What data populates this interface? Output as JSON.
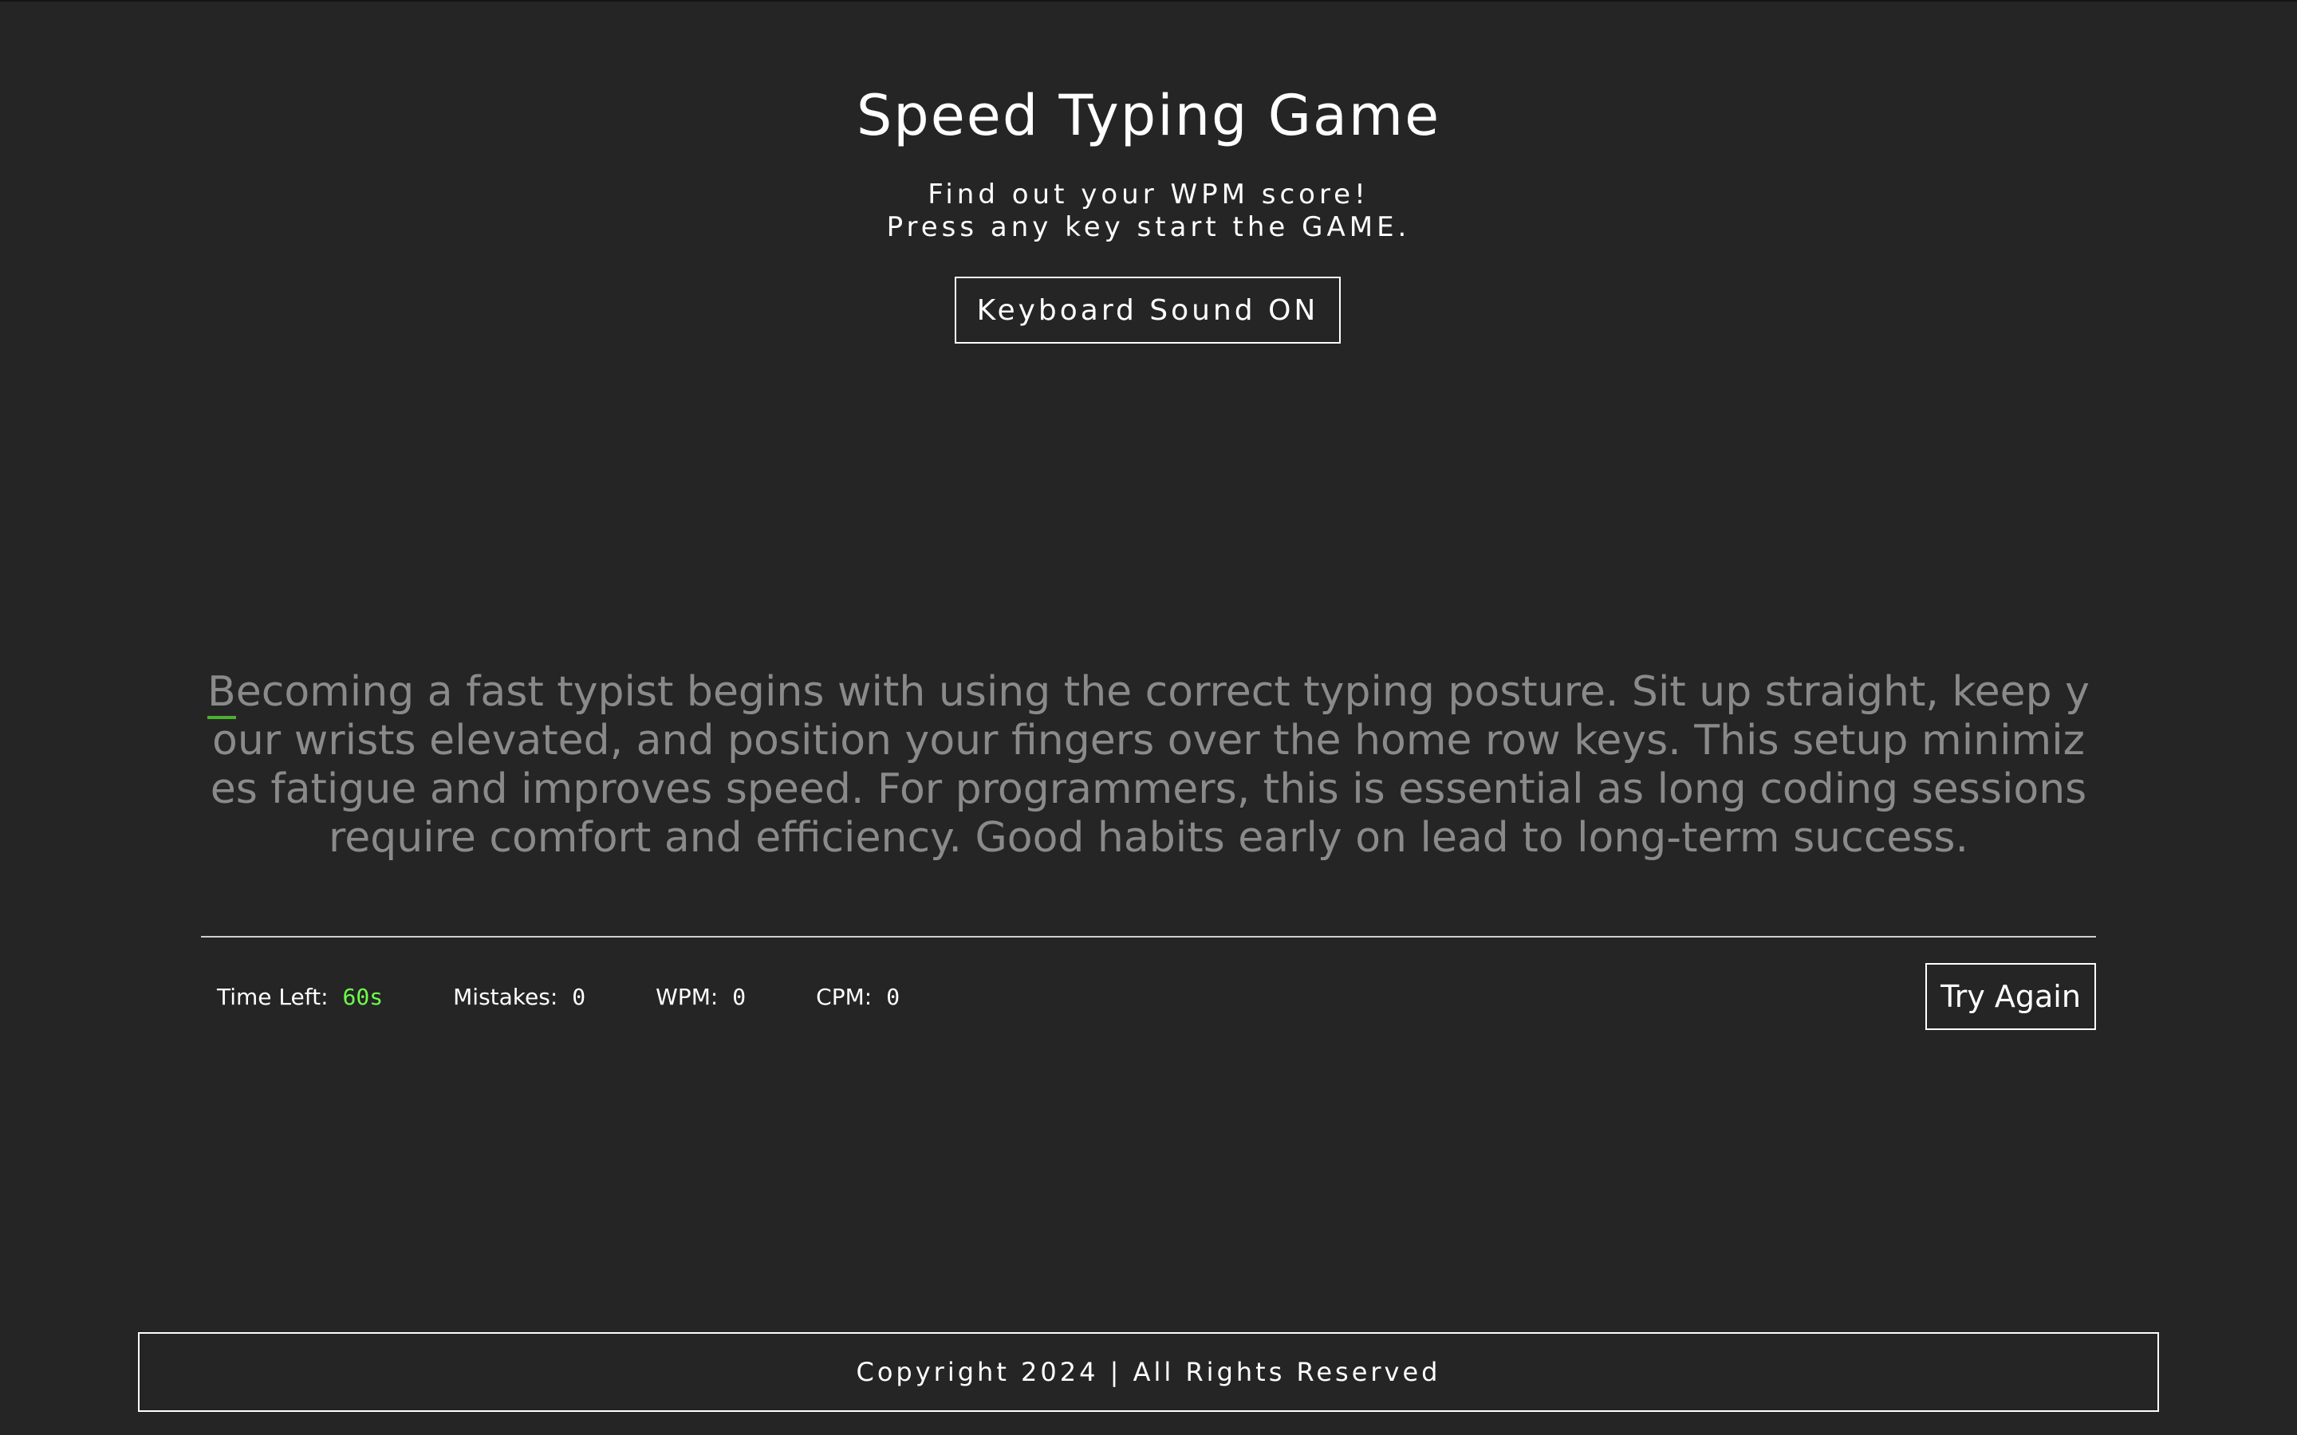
{
  "header": {
    "title": "Speed Typing Game",
    "subtitle_line1": "Find out your WPM score!",
    "subtitle_line2": "Press any key start the GAME.",
    "sound_button_label": "Keyboard Sound ON"
  },
  "passage": {
    "current_char": "B",
    "remaining_text": "ecoming a fast typist begins with using the correct typing posture. Sit up straight, keep your wrists elevated, and position your fingers over the home row keys. This setup minimizes fatigue and improves speed. For programmers, this is essential as long coding sessions require comfort and efficiency. Good habits early on lead to long-term success."
  },
  "stats": {
    "time_label": "Time Left:",
    "time_value": "60s",
    "mistakes_label": "Mistakes:",
    "mistakes_value": "0",
    "wpm_label": "WPM:",
    "wpm_value": "0",
    "cpm_label": "CPM:",
    "cpm_value": "0"
  },
  "try_again_label": "Try Again",
  "footer": {
    "copyright": "Copyright 2024 | All Rights Reserved"
  },
  "colors": {
    "background": "#252525",
    "time_accent": "#6cff4a",
    "cursor_underline": "#4caf2f",
    "pending_text": "#8a8a8a"
  }
}
